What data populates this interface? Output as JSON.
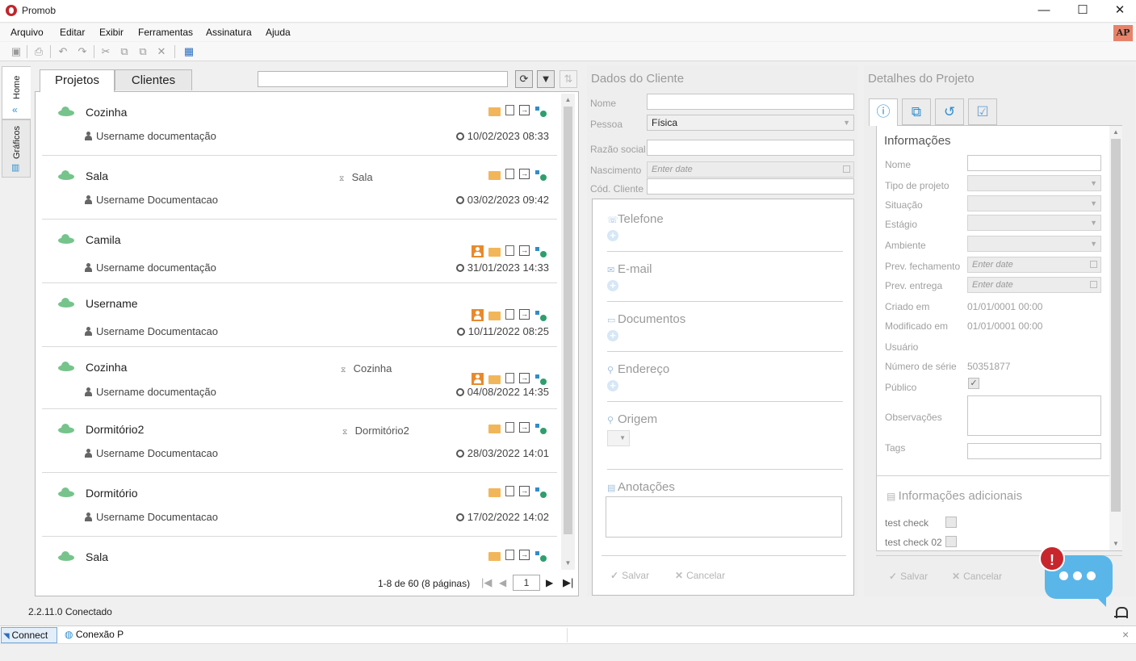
{
  "window": {
    "title": "Promob",
    "minimize": "—",
    "maximize": "☐",
    "close": "✕"
  },
  "menu": [
    "Arquivo",
    "Editar",
    "Exibir",
    "Ferramentas",
    "Assinatura",
    "Ajuda"
  ],
  "account": {
    "initials": "AP"
  },
  "toolbar": {
    "icons": [
      "save-icon",
      "print-icon",
      "undo-icon",
      "redo-icon",
      "cut-icon",
      "copy-icon",
      "paste-icon",
      "delete-icon",
      "layout-icon"
    ],
    "glyphs": [
      "▣",
      "⎙",
      "↶",
      "↷",
      "✂",
      "⧉",
      "⧉",
      "✕",
      "▦"
    ]
  },
  "side_tabs": {
    "home": "Home",
    "graficos": "Gráficos"
  },
  "left_panel": {
    "tabs": [
      "Projetos",
      "Clientes"
    ],
    "search_value": "",
    "refresh_glyph": "⟳",
    "filter_glyph": "▼",
    "sort_glyph": "⇅",
    "projects": [
      {
        "name": "Cozinha",
        "environment": "",
        "user": "Username documentação",
        "date": "10/02/2023 08:33",
        "has_client": false
      },
      {
        "name": "Sala",
        "environment": "Sala",
        "user": "Username Documentacao",
        "date": "03/02/2023 09:42",
        "has_client": false
      },
      {
        "name": "Camila",
        "environment": "",
        "user": "Username documentação",
        "date": "31/01/2023 14:33",
        "has_client": true
      },
      {
        "name": "Username",
        "environment": "",
        "user": "Username Documentacao",
        "date": "10/11/2022 08:25",
        "has_client": true
      },
      {
        "name": "Cozinha",
        "environment": "Cozinha",
        "user": "Username documentação",
        "date": "04/08/2022 14:35",
        "has_client": true
      },
      {
        "name": "Dormitório2",
        "environment": "Dormitório2",
        "user": "Username Documentacao",
        "date": "28/03/2022 14:01",
        "has_client": false
      },
      {
        "name": "Dormitório",
        "environment": "",
        "user": "Username Documentacao",
        "date": "17/02/2022 14:02",
        "has_client": false
      },
      {
        "name": "Sala",
        "environment": "",
        "user": "",
        "date": "",
        "has_client": false
      }
    ],
    "pager": {
      "summary": "1-8 de 60 (8 páginas)",
      "current_page": "1",
      "first": "|◀",
      "prev": "◀",
      "next": "▶",
      "last": "▶|"
    }
  },
  "client_panel": {
    "title": "Dados do Cliente",
    "fields": {
      "nome": "Nome",
      "pessoa": "Pessoa",
      "pessoa_value": "Física",
      "razao": "Razão social",
      "nascimento": "Nascimento",
      "nascimento_placeholder": "Enter date",
      "cod": "Cód. Cliente"
    },
    "sections": {
      "telefone": "Telefone",
      "email": "E-mail",
      "documentos": "Documentos",
      "endereco": "Endereço",
      "origem": "Origem",
      "anotacoes": "Anotações"
    },
    "save": "Salvar",
    "cancel": "Cancelar"
  },
  "project_panel": {
    "title": "Detalhes do Projeto",
    "tabs": [
      "info-icon",
      "tree-icon",
      "history-icon",
      "checklist-icon"
    ],
    "tab_glyphs": [
      "ⓘ",
      "⧉",
      "↺",
      "☑"
    ],
    "section_title": "Informações",
    "labels": {
      "nome": "Nome",
      "tipo": "Tipo de projeto",
      "situacao": "Situação",
      "estagio": "Estágio",
      "ambiente": "Ambiente",
      "prev_fech": "Prev. fechamento",
      "prev_entrega": "Prev. entrega",
      "criado": "Criado em",
      "modificado": "Modificado em",
      "usuario": "Usuário",
      "serie": "Número de série",
      "publico": "Público",
      "observacoes": "Observações",
      "tags": "Tags"
    },
    "values": {
      "date_placeholder": "Enter date",
      "criado": "01/01/0001 00:00",
      "modificado": "01/01/0001 00:00",
      "serie": "50351877",
      "publico_checked": "✓"
    },
    "additional_title": "Informações adicionais",
    "checks": [
      "test check",
      "test check 02"
    ],
    "save": "Salvar",
    "cancel": "Cancelar"
  },
  "status": {
    "text": "2.2.11.0 Conectado"
  },
  "bottom": {
    "connect": "Connect",
    "conexao": "Conexão P",
    "close": "×"
  },
  "chat_widget": {
    "alert": "!"
  },
  "colors": {
    "accent": "#2d8fd1",
    "cloud": "#76c48c",
    "client_badge": "#e88a2c",
    "folder": "#f2b65a",
    "alert": "#c8262d",
    "chat": "#5ab6e8"
  }
}
